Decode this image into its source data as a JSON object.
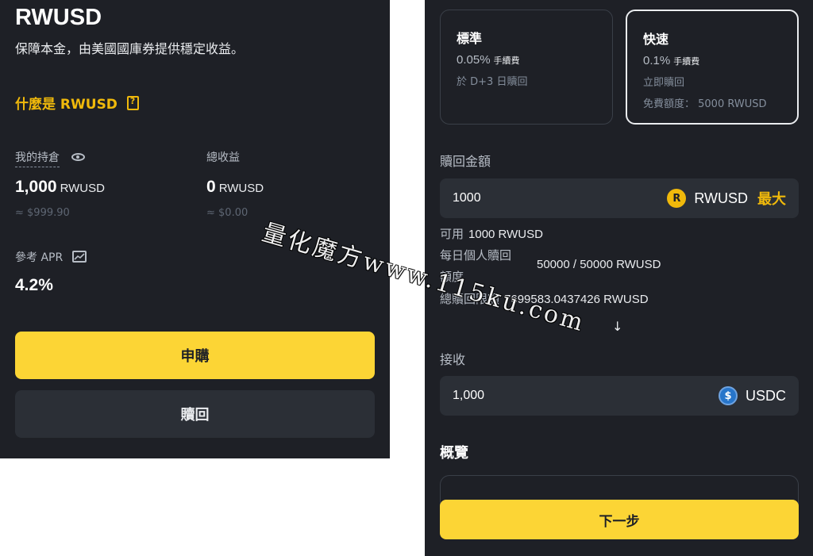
{
  "left": {
    "coin_title": "RWUSD",
    "subtitle": "保障本金，由美國國庫券提供穩定收益。",
    "what_is_link": "什麼是 RWUSD",
    "holdings": {
      "label": "我的持倉",
      "value": "1,000",
      "unit": "RWUSD",
      "approx": "≈ $999.90"
    },
    "earnings": {
      "label": "總收益",
      "value": "0",
      "unit": "RWUSD",
      "approx": "≈ $0.00"
    },
    "apr": {
      "label": "參考 APR",
      "value": "4.2%"
    },
    "subscribe_button": "申購",
    "redeem_button": "贖回"
  },
  "right": {
    "options": [
      {
        "title": "標準",
        "fee": "0.05%",
        "fee_label": "手續費",
        "line1": "於 D+3 日贖回",
        "line2": ""
      },
      {
        "title": "快速",
        "fee": "0.1%",
        "fee_label": "手續費",
        "line1": "立即贖回",
        "line2": "免費額度：  5000 RWUSD"
      }
    ],
    "redeem_amount_label": "贖回金額",
    "redeem_amount_value": "1000",
    "redeem_token": "RWUSD",
    "max_label": "最大",
    "available_label": "可用",
    "available_value": "1000 RWUSD",
    "daily_limit_label_1": "每日個人贖回",
    "daily_limit_label_2": "額度",
    "daily_limit_value": "50000 / 50000 RWUSD",
    "total_limit_label": "總贖回限額",
    "total_limit_value": "7699583.0437426 RWUSD",
    "arrow": "↓",
    "receive_label": "接收",
    "receive_value": "1,000",
    "receive_token": "USDC",
    "overview_title": "概覽",
    "next_button": "下一步"
  },
  "icons": {
    "rwusd_glyph": "R",
    "usdc_glyph": "$"
  },
  "watermark": "量化魔方www.115ku.com",
  "colors": {
    "bg": "#1e2026",
    "accent_yellow": "#fcd535",
    "brand_gold": "#f0b90b",
    "usdc_blue": "#2775ca"
  }
}
